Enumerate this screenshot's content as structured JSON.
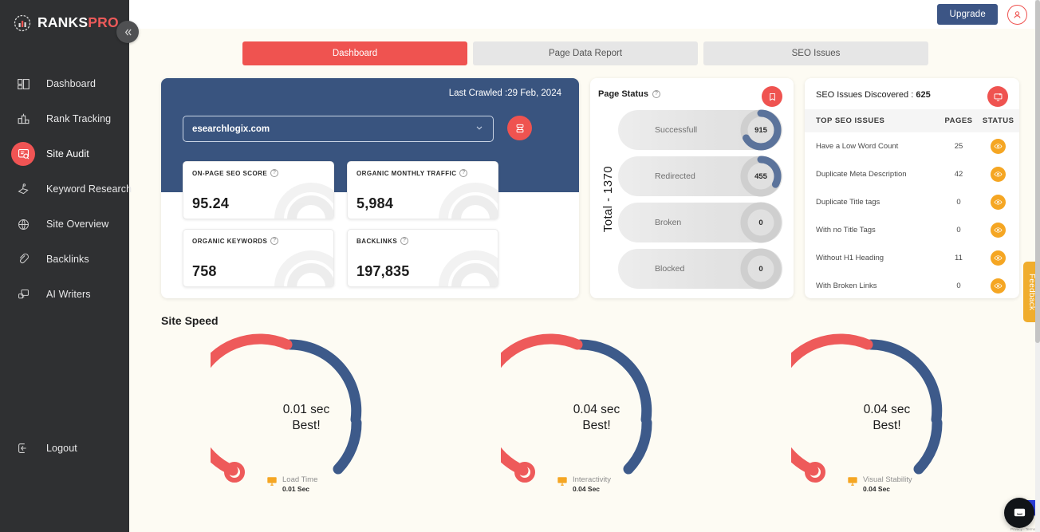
{
  "brand": {
    "ranks": "RANKS",
    "pro": "PRO"
  },
  "sidebar": {
    "collapse_icon": "chevron-double-left-icon",
    "items": [
      {
        "label": "Dashboard",
        "icon": "dashboard-icon",
        "active": false
      },
      {
        "label": "Rank Tracking",
        "icon": "rank-tracking-icon",
        "active": false
      },
      {
        "label": "Site Audit",
        "icon": "site-audit-icon",
        "active": true
      },
      {
        "label": "Keyword Research",
        "icon": "keyword-research-icon",
        "active": false
      },
      {
        "label": "Site Overview",
        "icon": "globe-icon",
        "active": false
      },
      {
        "label": "Backlinks",
        "icon": "link-icon",
        "active": false
      },
      {
        "label": "AI Writers",
        "icon": "ai-writer-icon",
        "active": false
      }
    ],
    "logout": {
      "label": "Logout",
      "icon": "logout-icon"
    }
  },
  "topbar": {
    "upgrade_label": "Upgrade",
    "avatar_icon": "user-avatar-icon"
  },
  "tabs": [
    {
      "label": "Dashboard",
      "active": true
    },
    {
      "label": "Page Data Report",
      "active": false
    },
    {
      "label": "SEO Issues",
      "active": false
    }
  ],
  "overview": {
    "last_crawled": "Last Crawled :29 Feb, 2024",
    "site_value": "esearchlogix.com",
    "dropdown_icon": "chevron-down-icon",
    "refresh_icon": "recrawl-icon",
    "metrics": [
      {
        "label": "ON-PAGE SEO SCORE",
        "value": "95.24",
        "help": "?"
      },
      {
        "label": "ORGANIC MONTHLY TRAFFIC",
        "value": "5,984",
        "help": "?"
      },
      {
        "label": "ORGANIC KEYWORDS",
        "value": "758",
        "help": "?"
      },
      {
        "label": "BACKLINKS",
        "value": "197,835",
        "help": "?"
      }
    ]
  },
  "page_status": {
    "title": "Page Status",
    "help": "?",
    "action_icon": "report-icon",
    "total_label": "Total - 1370",
    "rows": [
      {
        "label": "Successfull",
        "value": "915",
        "pct": 67
      },
      {
        "label": "Redirected",
        "value": "455",
        "pct": 33
      },
      {
        "label": "Broken",
        "value": "0",
        "pct": 0
      },
      {
        "label": "Blocked",
        "value": "0",
        "pct": 0
      }
    ]
  },
  "seo_issues": {
    "title": "SEO Issues Discovered :",
    "count": "625",
    "action_icon": "monitor-report-icon",
    "columns": [
      "TOP SEO ISSUES",
      "PAGES",
      "STATUS"
    ],
    "rows": [
      {
        "issue": "Have a Low Word Count",
        "pages": "25",
        "status_icon": "eye-icon"
      },
      {
        "issue": "Duplicate Meta Description",
        "pages": "42",
        "status_icon": "eye-icon"
      },
      {
        "issue": "Duplicate Title tags",
        "pages": "0",
        "status_icon": "eye-icon"
      },
      {
        "issue": "With no Title Tags",
        "pages": "0",
        "status_icon": "eye-icon"
      },
      {
        "issue": "Without H1 Heading",
        "pages": "11",
        "status_icon": "eye-icon"
      },
      {
        "issue": "With Broken Links",
        "pages": "0",
        "status_icon": "eye-icon"
      }
    ]
  },
  "site_speed": {
    "title": "Site Speed",
    "gauges": [
      {
        "value": "0.01 sec",
        "rating": "Best!",
        "legend_label": "Load Time",
        "legend_value": "0.01 Sec",
        "legend_icon": "monitor-icon"
      },
      {
        "value": "0.04 sec",
        "rating": "Best!",
        "legend_label": "Interactivity",
        "legend_value": "0.04 Sec",
        "legend_icon": "monitor-icon"
      },
      {
        "value": "0.04 sec",
        "rating": "Best!",
        "legend_label": "Visual Stability",
        "legend_value": "0.04 Sec",
        "legend_icon": "monitor-icon"
      }
    ]
  },
  "feedback": {
    "label": "Feedback"
  },
  "chat": {
    "icon": "chat-bubble-icon",
    "terms": "Privacy - Terms"
  },
  "colors": {
    "accent_red": "#ef5350",
    "brand_blue": "#39547f",
    "sidebar_bg": "#2f3032",
    "page_bg": "#fdfbf3",
    "amber": "#f5a623",
    "gauge_blue": "#3d5a8a",
    "gauge_red": "#ee5a5a"
  }
}
